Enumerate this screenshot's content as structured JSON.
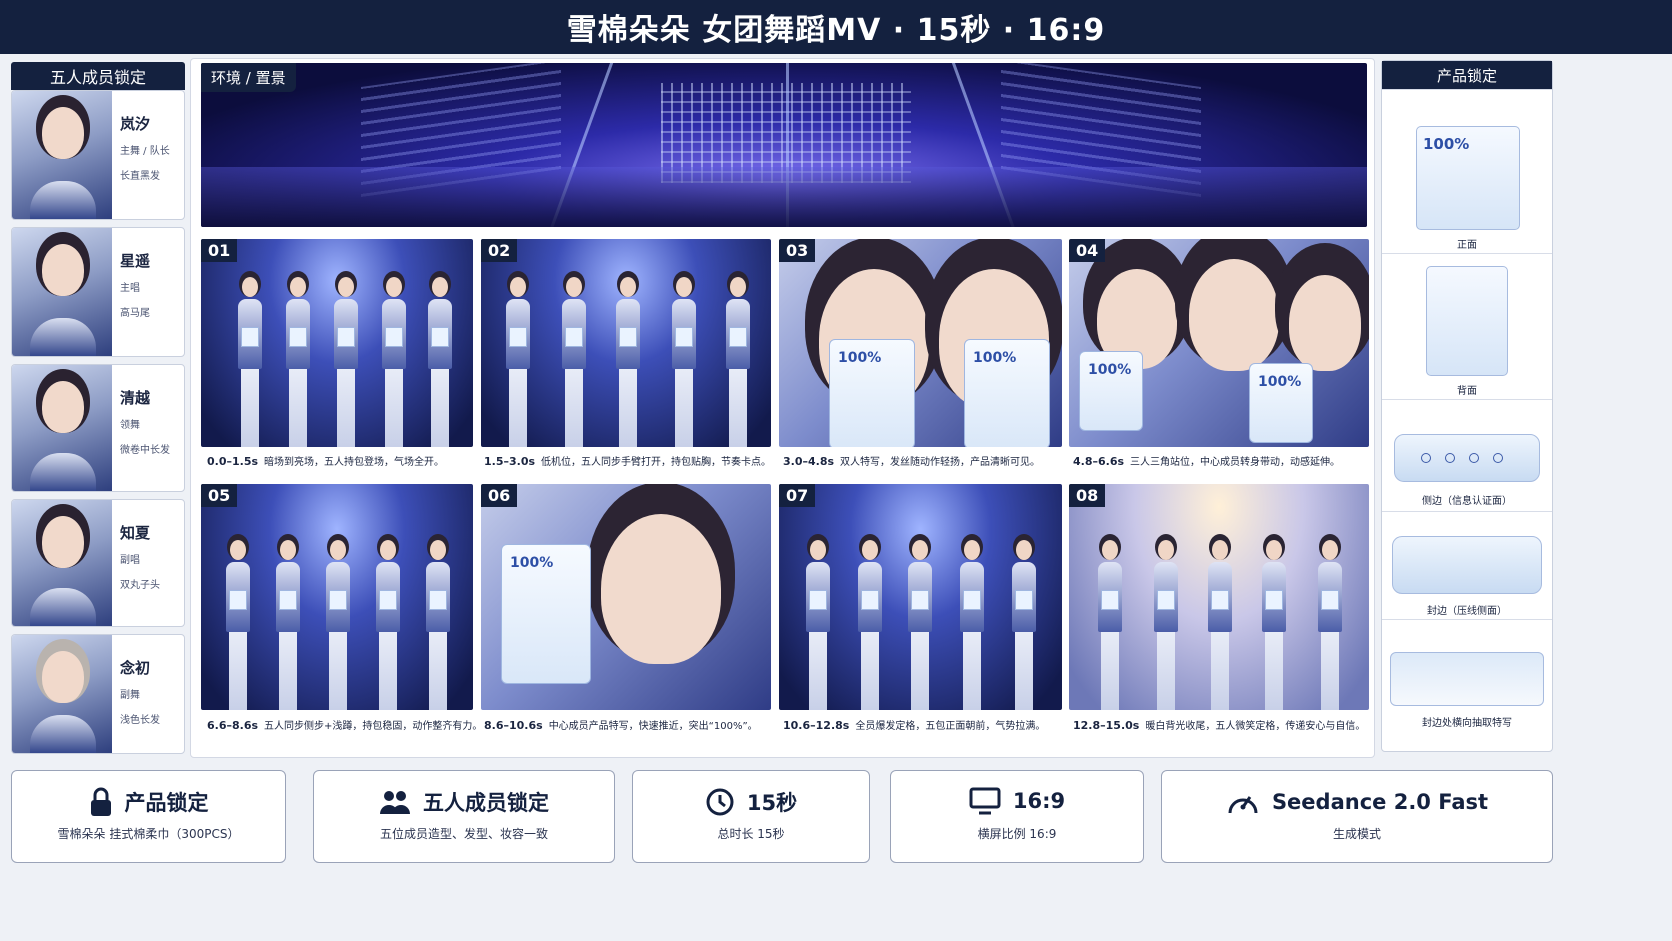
{
  "title": "雪棉朵朵 女团舞蹈MV · 15秒 · 16:9",
  "members": {
    "header": "五人成员锁定",
    "list": [
      {
        "name": "岚汐",
        "role": "主舞 / 队长",
        "hair": "长直黑发"
      },
      {
        "name": "星遥",
        "role": "主唱",
        "hair": "高马尾"
      },
      {
        "name": "清越",
        "role": "领舞",
        "hair": "微卷中长发"
      },
      {
        "name": "知夏",
        "role": "副唱",
        "hair": "双丸子头"
      },
      {
        "name": "念初",
        "role": "副舞",
        "hair": "浅色长发"
      }
    ]
  },
  "environment": {
    "tag": "环境 / 置景"
  },
  "shots": [
    {
      "num": "01",
      "time": "0.0–1.5s",
      "desc": "暗场到亮场，五人持包登场，气场全开。"
    },
    {
      "num": "02",
      "time": "1.5–3.0s",
      "desc": "低机位，五人同步手臂打开，持包贴胸，节奏卡点。"
    },
    {
      "num": "03",
      "time": "3.0–4.8s",
      "desc": "双人特写，发丝随动作轻扬，产品清晰可见。"
    },
    {
      "num": "04",
      "time": "4.8–6.6s",
      "desc": "三人三角站位，中心成员转身带动，动感延伸。"
    },
    {
      "num": "05",
      "time": "6.6–8.6s",
      "desc": "五人同步侧步+浅蹲，持包稳固，动作整齐有力。"
    },
    {
      "num": "06",
      "time": "8.6–10.6s",
      "desc": "中心成员产品特写，快速推近，突出“100%”。"
    },
    {
      "num": "07",
      "time": "10.6–12.8s",
      "desc": "全员爆发定格，五包正面朝前，气势拉满。"
    },
    {
      "num": "08",
      "time": "12.8–15.0s",
      "desc": "暖白背光收尾，五人微笑定格，传递安心与自信。"
    }
  ],
  "pack_text": "100%",
  "products": {
    "header": "产品锁定",
    "views": [
      "正面",
      "背面",
      "侧边（信息认证面）",
      "封边（压线侧面）",
      "封边处横向抽取特写"
    ]
  },
  "info_cards": [
    {
      "title": "产品锁定",
      "sub": "雪棉朵朵 挂式棉柔巾（300PCS）",
      "icon": "lock-icon"
    },
    {
      "title": "五人成员锁定",
      "sub": "五位成员造型、发型、妆容一致",
      "icon": "group-icon"
    },
    {
      "title": "15秒",
      "sub": "总时长 15秒",
      "icon": "clock-icon"
    },
    {
      "title": "16:9",
      "sub": "横屏比例 16:9",
      "icon": "monitor-icon"
    },
    {
      "title": "Seedance 2.0 Fast",
      "sub": "生成模式",
      "icon": "gauge-icon"
    }
  ],
  "colors": {
    "navy": "#14213f",
    "accent": "#2d4fa6"
  }
}
